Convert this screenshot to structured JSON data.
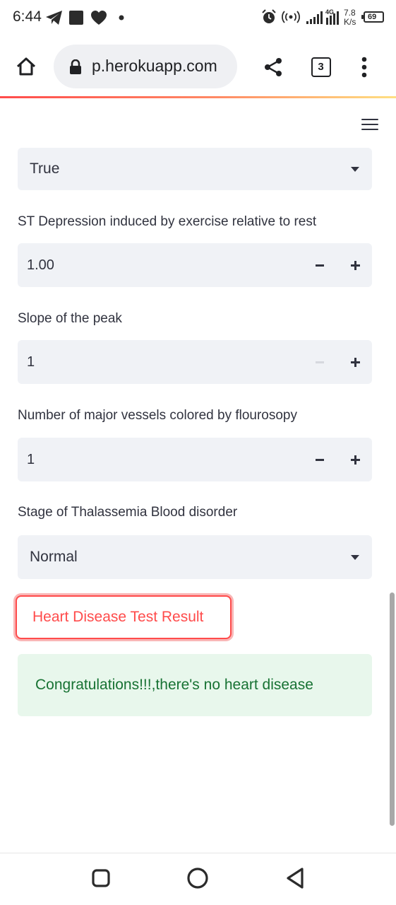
{
  "status_bar": {
    "time": "6:44",
    "network_label": "4G",
    "speed_value": "7.8",
    "speed_unit": "K/s",
    "battery": "69",
    "icons": [
      "telegram-icon",
      "square-notification-icon",
      "heart-icon",
      "dot-icon",
      "alarm-icon",
      "hotspot-icon",
      "signal-icon",
      "signal-4g-icon",
      "battery-icon"
    ]
  },
  "browser": {
    "url": "p.herokuapp.com",
    "tab_count": "3",
    "icons": [
      "home-icon",
      "lock-icon",
      "share-icon",
      "tabs-icon",
      "more-icon"
    ]
  },
  "app": {
    "menu_icon": "hamburger-menu-icon",
    "exang_select": {
      "value": "True"
    },
    "oldpeak": {
      "label": "ST Depression induced by exercise relative to rest",
      "value": "1.00",
      "minus": "−",
      "plus": "+"
    },
    "slope": {
      "label": "Slope of the peak",
      "value": "1",
      "minus": "−",
      "plus": "+"
    },
    "vessels": {
      "label": "Number of major vessels colored by flourosopy",
      "value": "1",
      "minus": "−",
      "plus": "+"
    },
    "thal": {
      "label": "Stage of Thalassemia Blood disorder",
      "value": "Normal"
    },
    "submit_button": {
      "label": "Heart Disease Test Result"
    },
    "result": {
      "text": "Congratulations!!!,there's no heart disease"
    }
  },
  "colors": {
    "accent": "#ff4b4b",
    "input_bg": "#f0f2f6",
    "success_bg": "#e8f7ec",
    "success_text": "#177233",
    "text": "#31333f"
  },
  "nav_bar": {
    "icons": [
      "recents-icon",
      "home-circle-icon",
      "back-triangle-icon"
    ]
  }
}
